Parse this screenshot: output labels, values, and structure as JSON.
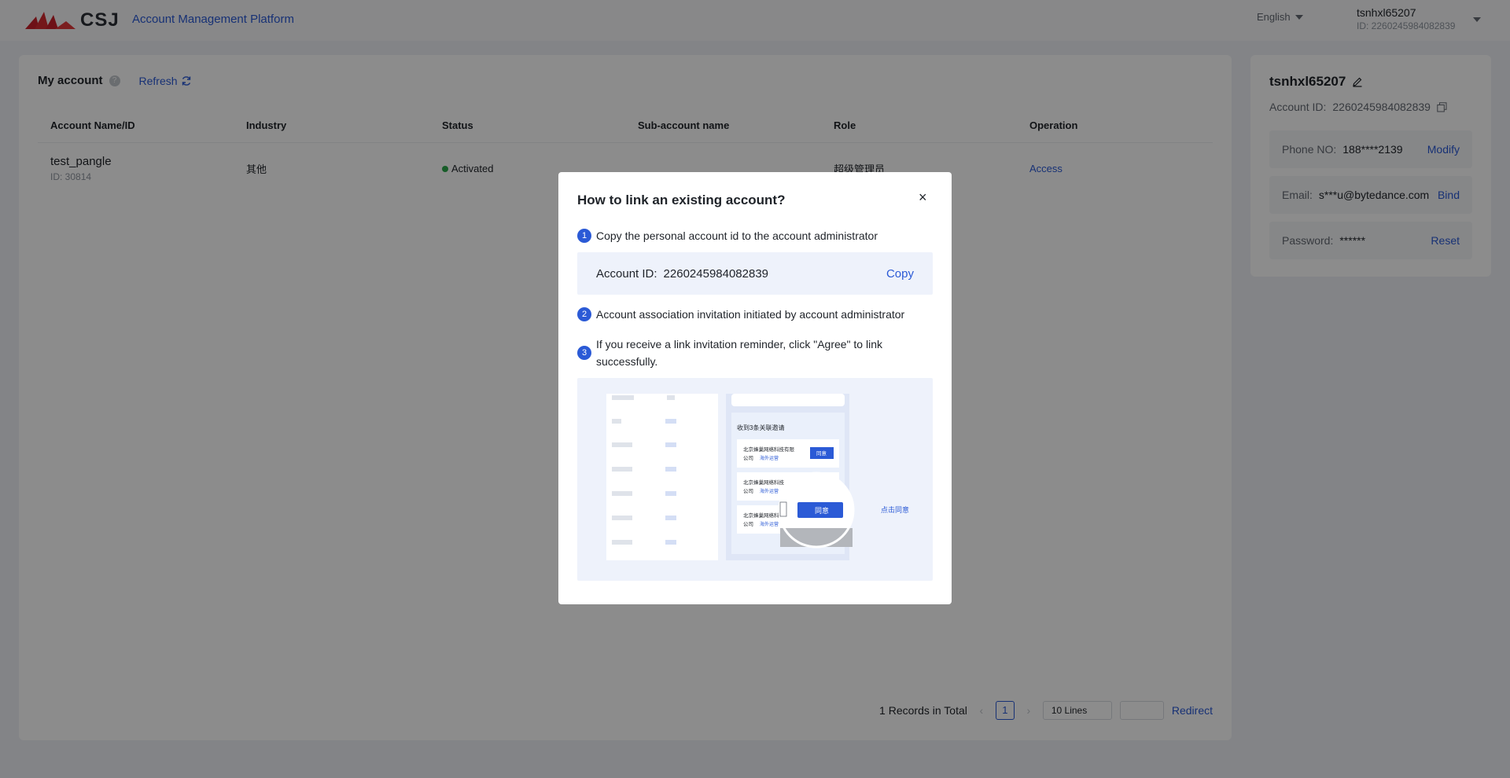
{
  "header": {
    "logo_text": "CSJ",
    "platform_title": "Account Management Platform",
    "language": "English",
    "user_name": "tsnhxl65207",
    "user_id": "ID: 2260245984082839"
  },
  "main": {
    "title": "My account",
    "refresh_label": "Refresh",
    "columns": [
      "Account Name/ID",
      "Industry",
      "Status",
      "Sub-account name",
      "Role",
      "Operation"
    ],
    "rows": [
      {
        "name": "test_pangle",
        "id": "ID: 30814",
        "industry": "其他",
        "status": "Activated",
        "sub_account": "",
        "role": "超级管理员",
        "operation": "Access"
      }
    ],
    "pagination": {
      "total_text": "1 Records in Total",
      "prev": "‹",
      "current_page": "1",
      "next": "›",
      "page_size": "10 Lines",
      "redirect_label": "Redirect"
    }
  },
  "profile": {
    "name": "tsnhxl65207",
    "account_id_label": "Account ID:",
    "account_id": "2260245984082839",
    "phone_label": "Phone NO:",
    "phone": "188****2139",
    "phone_action": "Modify",
    "email_label": "Email:",
    "email": "s***u@bytedance.com",
    "email_action": "Bind",
    "password_label": "Password:",
    "password": "******",
    "password_action": "Reset"
  },
  "modal": {
    "title": "How to link an existing account?",
    "close": "×",
    "step1_num": "1",
    "step1": "Copy the personal account id to the account administrator",
    "id_label": "Account ID:",
    "id_value": "2260245984082839",
    "copy_label": "Copy",
    "step2_num": "2",
    "step2": "Account association invitation initiated by account administrator",
    "step3_num": "3",
    "step3": "If you receive a link invitation reminder, click \"Agree\" to link successfully.",
    "illustration": {
      "panel_title": "收到3条关联邀请",
      "company1_line1": "北京蜂巢网络科技有限",
      "company1_line2": "公司",
      "company_tag": "海外运营",
      "company2_line1": "北京蜂巢网络科技",
      "company3_line1": "北京蜂巢网络科",
      "agree": "同意",
      "click_agree": "点击同意"
    }
  },
  "colors": {
    "accent": "#2b5ad6",
    "status_green": "#2aa84a",
    "overlay": "rgba(0,0,0,0.45)"
  }
}
